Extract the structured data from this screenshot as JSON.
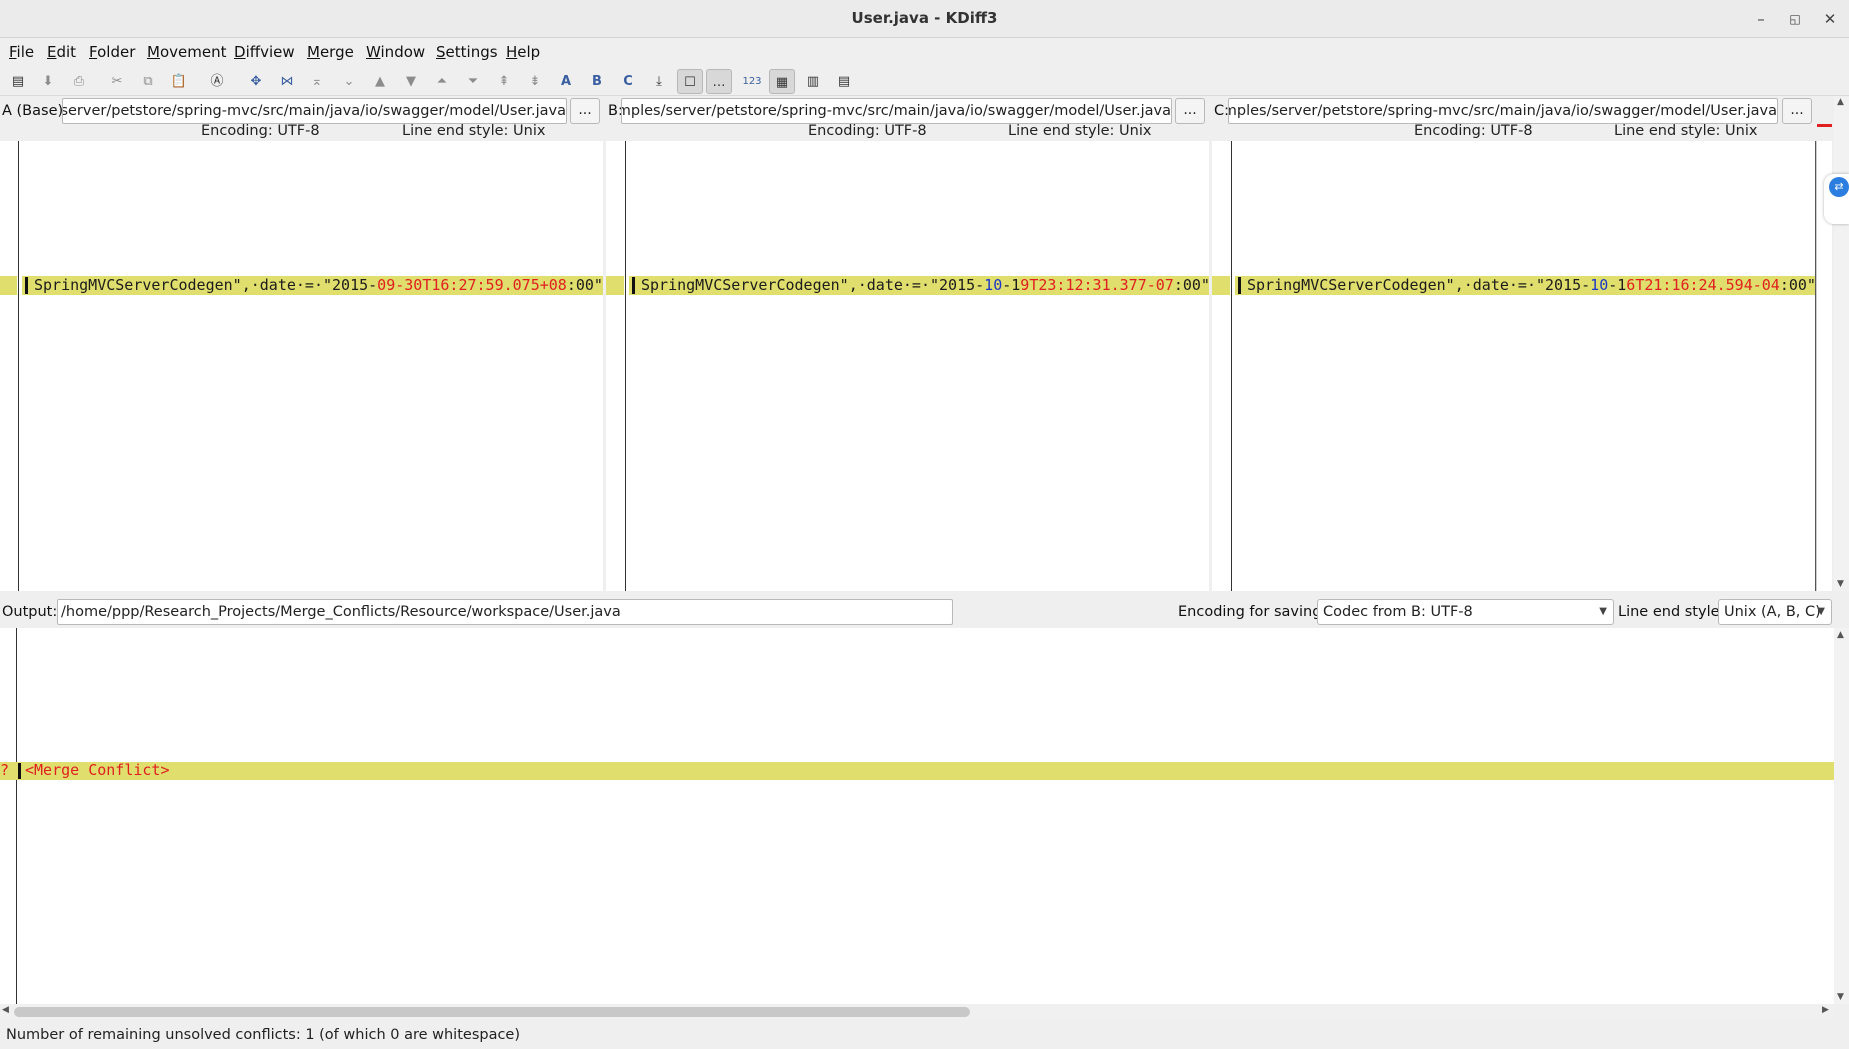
{
  "window": {
    "title": "User.java - KDiff3",
    "minimize_icon": "–",
    "restore_icon": "◱",
    "close_icon": "✕"
  },
  "menu": [
    "File",
    "Edit",
    "Folder",
    "Movement",
    "Diffview",
    "Merge",
    "Window",
    "Settings",
    "Help"
  ],
  "toolbar": [
    {
      "name": "open-icon",
      "glyph": "▤"
    },
    {
      "name": "save-icon",
      "glyph": "⬇"
    },
    {
      "name": "print-icon",
      "glyph": "⎙"
    },
    {
      "name": "cut-icon",
      "glyph": "✂"
    },
    {
      "name": "copy-icon",
      "glyph": "⧉"
    },
    {
      "name": "paste-icon",
      "glyph": "📋"
    },
    {
      "name": "find-icon",
      "glyph": "Ⓐ"
    },
    {
      "name": "go-current-icon",
      "glyph": "✥"
    },
    {
      "name": "go-center-icon",
      "glyph": "⋈"
    },
    {
      "name": "go-top-icon",
      "glyph": "⌅"
    },
    {
      "name": "go-bottom-icon",
      "glyph": "⌄"
    },
    {
      "name": "prev-delta-icon",
      "glyph": "▲"
    },
    {
      "name": "next-delta-icon",
      "glyph": "▼"
    },
    {
      "name": "prev-conflict-icon",
      "glyph": "⏶"
    },
    {
      "name": "next-conflict-icon",
      "glyph": "⏷"
    },
    {
      "name": "prev-unsolved-icon",
      "glyph": "⇞"
    },
    {
      "name": "next-unsolved-icon",
      "glyph": "⇟"
    },
    {
      "name": "select-a-icon",
      "glyph": "A"
    },
    {
      "name": "select-b-icon",
      "glyph": "B"
    },
    {
      "name": "select-c-icon",
      "glyph": "C"
    },
    {
      "name": "auto-advance-icon",
      "glyph": "⤓"
    },
    {
      "name": "show-whitespace-icon",
      "glyph": "☐"
    },
    {
      "name": "show-whitespace-chars-icon",
      "glyph": "…"
    },
    {
      "name": "line-numbers-icon",
      "glyph": "123"
    },
    {
      "name": "window-a-icon",
      "glyph": "▦"
    },
    {
      "name": "window-b-icon",
      "glyph": "▥"
    },
    {
      "name": "window-c-icon",
      "glyph": "▤"
    }
  ],
  "panes": {
    "a": {
      "label": "A (Base):",
      "path": "es/server/petstore/spring-mvc/src/main/java/io/swagger/model/User.java",
      "browse": "...",
      "encoding": "Encoding: UTF-8",
      "line_end": "Line end style: Unix",
      "line": [
        {
          "t": "SpringMVCServerCodegen\",·date·=·\"2015-",
          "c": ""
        },
        {
          "t": "09-30T16:27:59.075+08",
          "c": "r"
        },
        {
          "t": ":00\"",
          "c": ""
        }
      ]
    },
    "b": {
      "label": "B:",
      "path": "/samples/server/petstore/spring-mvc/src/main/java/io/swagger/model/User.java",
      "browse": "...",
      "encoding": "Encoding: UTF-8",
      "line_end": "Line end style: Unix",
      "line": [
        {
          "t": "SpringMVCServerCodegen\",·date·=·\"2015-",
          "c": ""
        },
        {
          "t": "10",
          "c": "b"
        },
        {
          "t": "-1",
          "c": ""
        },
        {
          "t": "9T23:12:31.377-07",
          "c": "r"
        },
        {
          "t": ":00\"",
          "c": ""
        }
      ]
    },
    "c": {
      "label": "C:",
      "path": "/samples/server/petstore/spring-mvc/src/main/java/io/swagger/model/User.java",
      "browse": "...",
      "encoding": "Encoding: UTF-8",
      "line_end": "Line end style: Unix",
      "line": [
        {
          "t": "SpringMVCServerCodegen\",·date·=·\"2015-",
          "c": ""
        },
        {
          "t": "10",
          "c": "b"
        },
        {
          "t": "-1",
          "c": ""
        },
        {
          "t": "6T21:16:24.594-04",
          "c": "r"
        },
        {
          "t": ":00\"",
          "c": ""
        }
      ]
    }
  },
  "output": {
    "label": "Output:",
    "path": "/home/ppp/Research_Projects/Merge_Conflicts/Resource/workspace/User.java",
    "encoding_label": "Encoding for saving:",
    "encoding_value": "Codec from B: UTF-8",
    "line_end_label": "Line end style:",
    "line_end_value": "Unix (A, B, C)",
    "conflict_marker": "?",
    "conflict_text": "<Merge Conflict>"
  },
  "status": "Number of remaining unsolved conflicts: 1 (of which 0 are whitespace)",
  "colors": {
    "conflict_highlight": "#e0de6c",
    "diff_red": "#e02020",
    "diff_blue": "#1a37c8"
  }
}
